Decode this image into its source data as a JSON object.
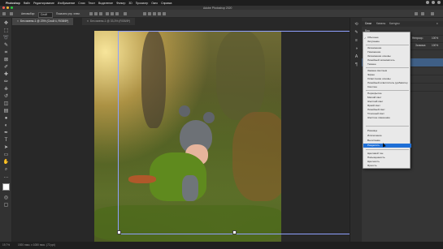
{
  "menubar": {
    "items": [
      "Photoshop",
      "Файл",
      "Редактирование",
      "Изображение",
      "Слои",
      "Текст",
      "Выделение",
      "Фильтр",
      "3D",
      "Просмотр",
      "Окно",
      "Справка"
    ]
  },
  "window": {
    "title": "Adobe Photoshop 2020"
  },
  "options": {
    "auto_select_label": "Автовыбор:",
    "auto_select_value": "Слой",
    "transform_label": "Показать упр. элем."
  },
  "tabs": [
    {
      "label": "Без имени-1 @ 23% (Слой 4, RGB/8*)",
      "active": true
    },
    {
      "label": "Без имени-1 @ 33,3% (RGB/8*)",
      "active": false
    }
  ],
  "panel": {
    "tabs": [
      "Слои",
      "Каналы",
      "Контуры"
    ],
    "kind_label": "Вид",
    "opacity_label": "Непрозр.:",
    "opacity_value": "100%",
    "fill_label": "Заливка:",
    "fill_value": "100%"
  },
  "blend_menu": {
    "groups": [
      [
        "Обычные",
        "Затухание"
      ],
      [
        "Затемнение",
        "Умножение",
        "Затемнение основы",
        "Линейный затемнитель",
        "Темнее"
      ],
      [
        "Замена светлым",
        "Экран",
        "Осветление основы",
        "Линейный осветлитель (добавить)",
        "Светлее"
      ],
      [
        "Перекрытие",
        "Мягкий свет",
        "Жесткий свет",
        "Яркий свет",
        "Линейный свет",
        "Точечный свет",
        "Жесткое смешение"
      ],
      [
        "Разница",
        "Исключение",
        "Вычитание",
        "Разделить"
      ],
      [
        "Цветовой тон",
        "Насыщенность",
        "Цветность",
        "Яркость"
      ]
    ],
    "checked": "Обычные",
    "highlighted": "Разделить"
  },
  "status": {
    "zoom": "19,7%",
    "doc": "1920 пикс. x 1080 пикс. (72 ppi)"
  },
  "colors": {
    "accent": "#1f6fd6",
    "menu_bg": "#e9e9e9",
    "workspace": "#282828"
  }
}
